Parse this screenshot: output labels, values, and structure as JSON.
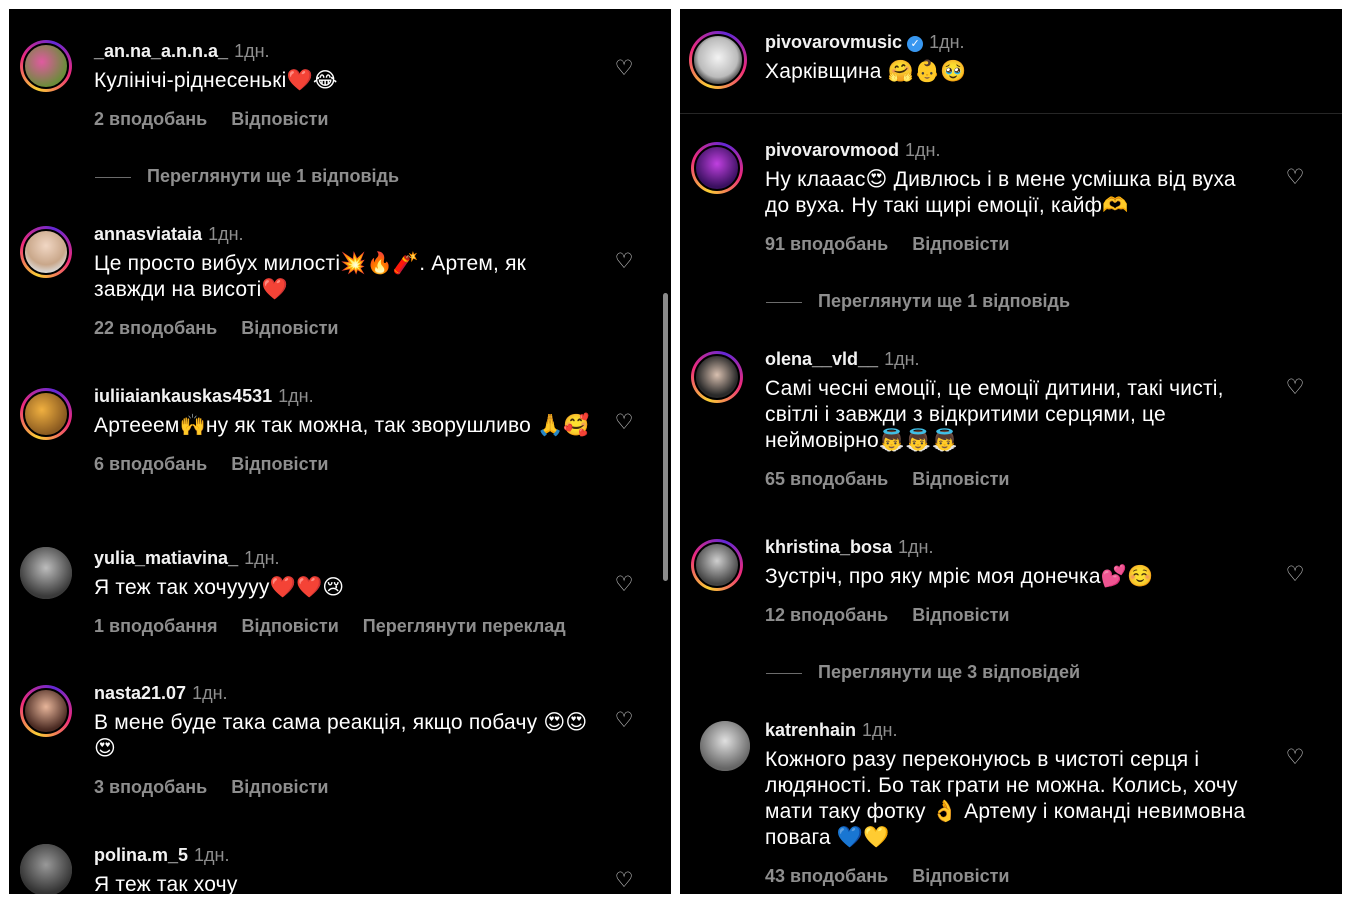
{
  "left": {
    "comments": [
      {
        "username": "_an.na_a.n.n.a_",
        "time": "1дн.",
        "text": "Кулінічі-ріднесенькі❤️😂",
        "likes": "2 вподобань",
        "reply": "Відповісти"
      },
      {
        "username": "annasviataia",
        "time": "1дн.",
        "text": "Це просто вибух милості💥🔥🧨. Артем, як завжди на висоті❤️",
        "likes": "22 вподобань",
        "reply": "Відповісти"
      },
      {
        "username": "iuliiaiankauskas4531",
        "time": "1дн.",
        "text": "Артееем🙌ну як так можна, так зворушливо 🙏🥰",
        "likes": "6 вподобань",
        "reply": "Відповісти"
      },
      {
        "username": "yulia_matiavina_",
        "time": "1дн.",
        "text": "Я теж так хочуууу❤️❤️😢",
        "likes": "1 вподобання",
        "reply": "Відповісти",
        "translate": "Переглянути переклад"
      },
      {
        "username": "nasta21.07",
        "time": "1дн.",
        "text": "В мене буде така сама реакція, якщо побачу 😍😍😍",
        "likes": "3 вподобань",
        "reply": "Відповісти"
      },
      {
        "username": "polina.m_5",
        "time": "1дн.",
        "text": "Я теж так хочу"
      }
    ],
    "view_more": "Переглянути ще 1 відповідь"
  },
  "right": {
    "comments": [
      {
        "username": "pivovarovmusic",
        "time": "1дн.",
        "text": "Харківщина 🤗👶🥹",
        "verified_icon": "verified-badge-icon"
      },
      {
        "username": "pivovarovmood",
        "time": "1дн.",
        "text": "Ну клааас😍 Дивлюсь і в мене усмішка від вуха до вуха. Ну такі щирі емоції, кайф🫶",
        "likes": "91 вподобань",
        "reply": "Відповісти"
      },
      {
        "username": "olena__vld__",
        "time": "1дн.",
        "text": "Самі чесні емоції, це емоції дитини, такі чисті, світлі і завжди з відкритими серцями, це неймовірно👼👼👼",
        "likes": "65 вподобань",
        "reply": "Відповісти"
      },
      {
        "username": "khristina_bosa",
        "time": "1дн.",
        "text": "Зустріч, про яку мріє моя донечка💕☺️",
        "likes": "12 вподобань",
        "reply": "Відповісти"
      },
      {
        "username": "katrenhain",
        "time": "1дн.",
        "text": "Кожного разу переконуюсь в чистоті серця і людяності. Бо так грати не можна. Колись, хочу мати таку фотку 👌 Артему і команді невимовна повага 💙💛",
        "likes": "43 вподобань",
        "reply": "Відповісти"
      }
    ],
    "view_more_1": "Переглянути ще 1 відповідь",
    "view_more_3": "Переглянути ще 3 відповідей"
  },
  "icons": {
    "like": "heart-outline-icon",
    "verified": "verified-badge-icon"
  },
  "colors": {
    "background": "#000000",
    "text": "#ffffff",
    "muted": "#8e8e8e",
    "verified": "#3897f0"
  }
}
